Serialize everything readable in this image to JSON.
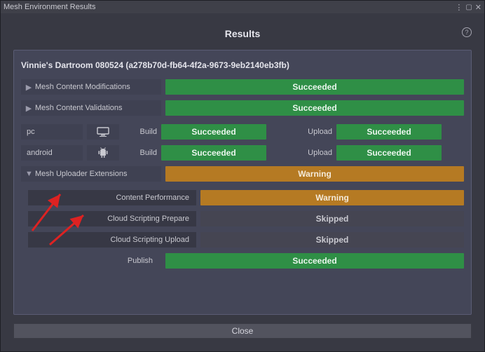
{
  "window": {
    "title": "Mesh Environment Results"
  },
  "header": {
    "title": "Results"
  },
  "project": {
    "name": "Vinnie's Dartroom 080524",
    "id_paren": "(a278b70d-fb64-4f2a-9673-9eb2140eb3fb)"
  },
  "status": {
    "succeeded": "Succeeded",
    "warning": "Warning",
    "skipped": "Skipped"
  },
  "rows": {
    "content_mods": "Mesh Content Modifications",
    "content_vals": "Mesh Content Validations",
    "build_label": "Build",
    "upload_label": "Upload",
    "publish_label": "Publish"
  },
  "platforms": {
    "pc": "pc",
    "android": "android"
  },
  "extensions": {
    "header": "Mesh Uploader Extensions",
    "content_perf": "Content Performance",
    "script_prepare": "Cloud Scripting Prepare",
    "script_upload": "Cloud Scripting Upload"
  },
  "footer": {
    "close": "Close"
  }
}
